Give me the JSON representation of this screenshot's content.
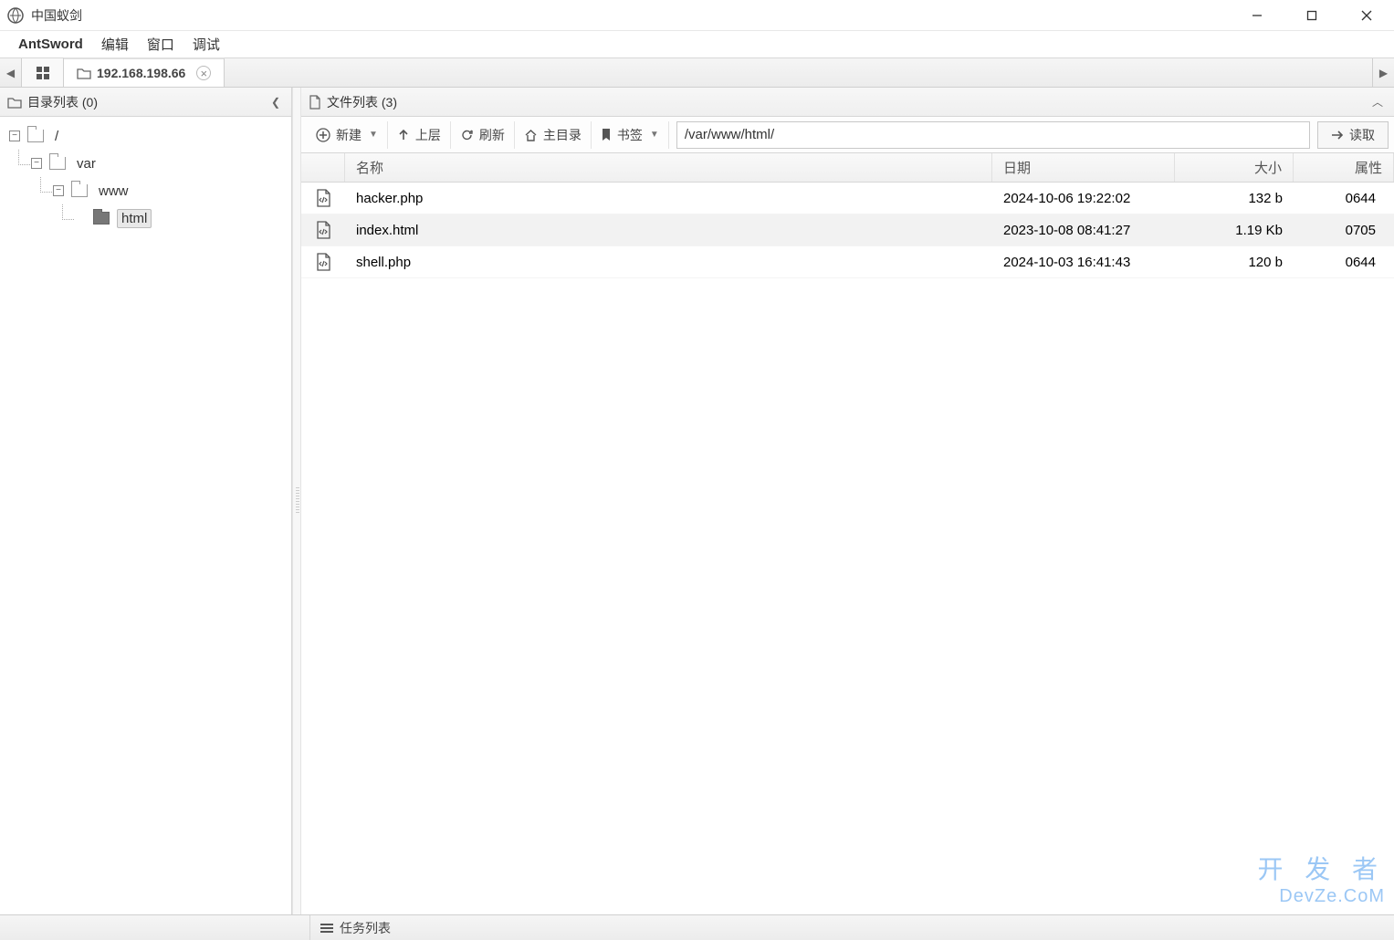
{
  "window": {
    "title": "中国蚁剑"
  },
  "menubar": {
    "items": [
      "AntSword",
      "编辑",
      "窗口",
      "调试"
    ]
  },
  "tabs": {
    "home_icon": "grid",
    "active": {
      "ip": "192.168.198.66"
    }
  },
  "sidebar": {
    "title": "目录列表 (0)",
    "tree": {
      "root": "/",
      "var": "var",
      "www": "www",
      "html": "html"
    }
  },
  "filepanel": {
    "title": "文件列表 (3)",
    "toolbar": {
      "new": "新建",
      "up": "上层",
      "refresh": "刷新",
      "home": "主目录",
      "bookmark": "书签",
      "path": "/var/www/html/",
      "read": "读取"
    },
    "columns": {
      "name": "名称",
      "date": "日期",
      "size": "大小",
      "attr": "属性"
    },
    "rows": [
      {
        "name": "hacker.php",
        "date": "2024-10-06 19:22:02",
        "size": "132 b",
        "attr": "0644",
        "selected": false
      },
      {
        "name": "index.html",
        "date": "2023-10-08 08:41:27",
        "size": "1.19 Kb",
        "attr": "0705",
        "selected": true
      },
      {
        "name": "shell.php",
        "date": "2024-10-03 16:41:43",
        "size": "120 b",
        "attr": "0644",
        "selected": false
      }
    ]
  },
  "bottombar": {
    "tasks": "任务列表"
  },
  "watermark": {
    "line1": "开 发 者",
    "line2": "DevZe.CoM"
  }
}
